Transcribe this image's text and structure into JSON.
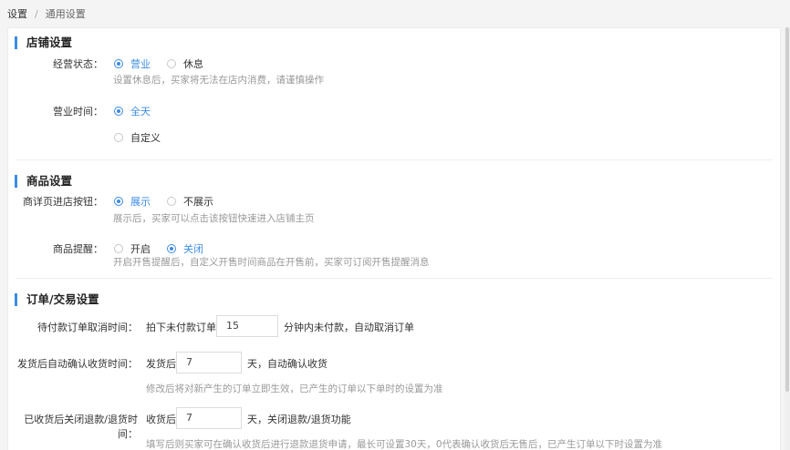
{
  "breadcrumb": {
    "root": "设置",
    "separator": "/",
    "current": "通用设置"
  },
  "store": {
    "title": "店铺设置",
    "status": {
      "label": "经营状态：",
      "options": [
        "营业",
        "休息"
      ],
      "selected": 0,
      "hint": "设置休息后，买家将无法在店内消费，请谨慎操作"
    },
    "hours": {
      "label": "营业时间：",
      "options": [
        "全天",
        "自定义"
      ],
      "selected": 0
    }
  },
  "product": {
    "title": "商品设置",
    "detail_button": {
      "label": "商详页进店按钮：",
      "options": [
        "展示",
        "不展示"
      ],
      "selected": 0,
      "hint": "展示后，买家可以点击该按钮快速进入店铺主页"
    },
    "reminder": {
      "label": "商品提醒：",
      "options": [
        "开启",
        "关闭"
      ],
      "selected": 1,
      "hint": "开启开售提醒后，自定义开售时间商品在开售前，买家可订阅开售提醒消息"
    }
  },
  "order": {
    "title": "订单/交易设置",
    "unpaid": {
      "label": "待付款订单取消时间：",
      "prefix": "拍下未付款订单",
      "value": "15",
      "suffix": "分钟内未付款，自动取消订单"
    },
    "confirm": {
      "label": "发货后自动确认收货时间：",
      "prefix": "发货后",
      "value": "7",
      "suffix": "天，自动确认收货",
      "hint": "修改后将对新产生的订单立即生效，已产生的订单以下单时的设置为准"
    },
    "refund": {
      "label": "已收货后关闭退款/退货时间：",
      "prefix": "收货后",
      "value": "7",
      "suffix": "天，关闭退款/退货功能",
      "hint": "填写后则买家可在确认收货后进行退款退货申请，最长可设置30天，0代表确认收货后无售后，已产生订单以下时设置为准"
    }
  }
}
